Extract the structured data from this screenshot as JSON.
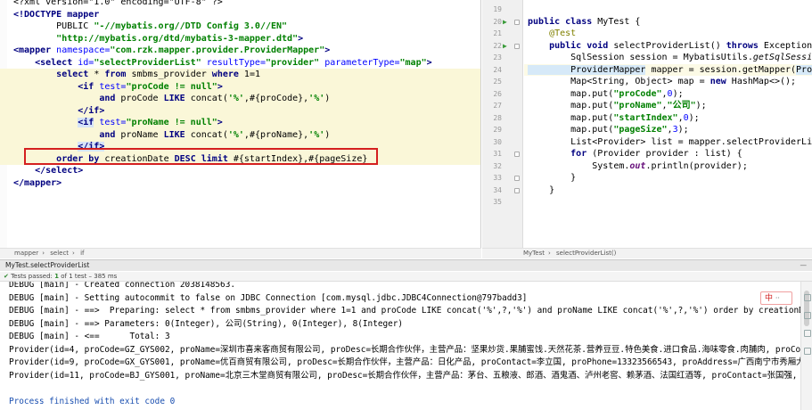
{
  "xml_editor": {
    "lines": [
      [
        {
          "c": "c-pl",
          "t": "<?xml version=\"1.0\" encoding=\"UTF-8\" ?>"
        }
      ],
      [
        {
          "c": "c-tag",
          "t": "<!DOCTYPE mapper"
        }
      ],
      [
        {
          "c": "c-pl",
          "t": "        PUBLIC "
        },
        {
          "c": "c-quoted",
          "t": "\"-//mybatis.org//DTD Config 3.0//EN\""
        }
      ],
      [
        {
          "c": "c-pl",
          "t": "        "
        },
        {
          "c": "c-quoted",
          "t": "\"http://mybatis.org/dtd/mybatis-3-mapper.dtd\""
        },
        {
          "c": "c-tag",
          "t": ">"
        }
      ],
      [
        {
          "c": "c-tag",
          "t": "<mapper "
        },
        {
          "c": "c-attr",
          "t": "namespace="
        },
        {
          "c": "c-str",
          "t": "\"com.rzk.mapper.provider.ProviderMapper\""
        },
        {
          "c": "c-tag",
          "t": ">"
        }
      ],
      [
        {
          "c": "c-tag",
          "t": "    <select "
        },
        {
          "c": "c-attr",
          "t": "id="
        },
        {
          "c": "c-str",
          "t": "\"selectProviderList\" "
        },
        {
          "c": "c-attr",
          "t": "resultType="
        },
        {
          "c": "c-str",
          "t": "\"provider\" "
        },
        {
          "c": "c-attr",
          "t": "parameterType="
        },
        {
          "c": "c-str",
          "t": "\"map\""
        },
        {
          "c": "c-tag",
          "t": ">"
        }
      ],
      [
        {
          "c": "c-sql",
          "t": "        "
        },
        {
          "c": "c-kw",
          "t": "select "
        },
        {
          "c": "c-sql",
          "t": "* "
        },
        {
          "c": "c-kw",
          "t": "from "
        },
        {
          "c": "c-sql",
          "t": "smbms_provider "
        },
        {
          "c": "c-kw",
          "t": "where "
        },
        {
          "c": "c-sql",
          "t": "1=1"
        }
      ],
      [
        {
          "c": "c-pl",
          "t": "            "
        },
        {
          "c": "c-tag",
          "t": "<if "
        },
        {
          "c": "c-attr",
          "t": "test="
        },
        {
          "c": "c-str",
          "t": "\"proCode != null\""
        },
        {
          "c": "c-tag",
          "t": ">"
        }
      ],
      [
        {
          "c": "c-pl",
          "t": "                "
        },
        {
          "c": "c-kw",
          "t": "and "
        },
        {
          "c": "c-sql",
          "t": "proCode "
        },
        {
          "c": "c-kw",
          "t": "LIKE "
        },
        {
          "c": "c-sql",
          "t": "concat("
        },
        {
          "c": "c-quoted",
          "t": "'%'"
        },
        {
          "c": "c-sql",
          "t": ",#{proCode},"
        },
        {
          "c": "c-quoted",
          "t": "'%'"
        },
        {
          "c": "c-sql",
          "t": ")"
        }
      ],
      [
        {
          "c": "c-pl",
          "t": "            "
        },
        {
          "c": "c-tag",
          "t": "</if>"
        }
      ],
      [
        {
          "c": "c-pl",
          "t": "            "
        },
        {
          "c": "c-tag match",
          "t": "<if"
        },
        {
          "c": "c-attr",
          "t": " test="
        },
        {
          "c": "c-str",
          "t": "\"proName != null\""
        },
        {
          "c": "c-tag",
          "t": ">"
        }
      ],
      [
        {
          "c": "c-pl",
          "t": "                "
        },
        {
          "c": "c-kw",
          "t": "and "
        },
        {
          "c": "c-sql",
          "t": "proName "
        },
        {
          "c": "c-kw",
          "t": "LIKE "
        },
        {
          "c": "c-sql",
          "t": "concat("
        },
        {
          "c": "c-quoted",
          "t": "'%'"
        },
        {
          "c": "c-sql",
          "t": ",#{proName},"
        },
        {
          "c": "c-quoted",
          "t": "'%'"
        },
        {
          "c": "c-sql",
          "t": ")"
        }
      ],
      [
        {
          "c": "c-pl",
          "t": "            "
        },
        {
          "c": "c-tag match",
          "t": "</if>"
        }
      ],
      [
        {
          "c": "c-pl",
          "t": "        "
        },
        {
          "c": "c-kw",
          "t": "order by "
        },
        {
          "c": "c-sql",
          "t": "creationDate "
        },
        {
          "c": "c-kw",
          "t": "DESC limit "
        },
        {
          "c": "c-sql",
          "t": "#{startIndex},#{pageSize}"
        }
      ],
      [
        {
          "c": "c-tag",
          "t": "    </select>"
        }
      ],
      [
        {
          "c": "c-tag",
          "t": "</mapper>"
        }
      ]
    ],
    "breadcrumbs": [
      "mapper",
      "select",
      "if"
    ]
  },
  "java_editor": {
    "line_numbers": [
      "19",
      "20",
      "21",
      "22",
      "23",
      "24",
      "25",
      "26",
      "27",
      "28",
      "29",
      "30",
      "31",
      "32",
      "33",
      "34",
      "35"
    ],
    "lines": [
      [
        {
          "c": "",
          "t": ""
        }
      ],
      [
        {
          "c": "j-kw",
          "t": "public class "
        },
        {
          "c": "",
          "t": "MyTest {"
        }
      ],
      [
        {
          "c": "j-ann",
          "t": "    @Test"
        }
      ],
      [
        {
          "c": "j-kw",
          "t": "    public void "
        },
        {
          "c": "",
          "t": "selectProviderList() "
        },
        {
          "c": "j-kw",
          "t": "throws "
        },
        {
          "c": "",
          "t": "Exception {"
        }
      ],
      [
        {
          "c": "",
          "t": "        SqlSession session = MybatisUtils."
        },
        {
          "c": "j-it",
          "t": "getSqlSessionFactory"
        },
        {
          "c": "",
          "t": "();"
        }
      ],
      [
        {
          "c": "j-hlcls",
          "t": "        ProviderMapper"
        },
        {
          "c": "",
          "t": " mapper = session.getMapper("
        },
        {
          "c": "j-hlcls",
          "t": "ProviderMapper"
        },
        {
          "c": "",
          "t": ".c"
        }
      ],
      [
        {
          "c": "",
          "t": "        Map<String, Object> map = "
        },
        {
          "c": "j-kw",
          "t": "new "
        },
        {
          "c": "",
          "t": "HashMap<>();"
        }
      ],
      [
        {
          "c": "",
          "t": "        map.put("
        },
        {
          "c": "j-str",
          "t": "\"proCode\""
        },
        {
          "c": "",
          "t": ","
        },
        {
          "c": "j-num",
          "t": "0"
        },
        {
          "c": "",
          "t": ");"
        }
      ],
      [
        {
          "c": "",
          "t": "        map.put("
        },
        {
          "c": "j-str",
          "t": "\"proName\""
        },
        {
          "c": "",
          "t": ","
        },
        {
          "c": "j-str",
          "t": "\"公司\""
        },
        {
          "c": "",
          "t": ");"
        }
      ],
      [
        {
          "c": "",
          "t": "        map.put("
        },
        {
          "c": "j-str",
          "t": "\"startIndex\""
        },
        {
          "c": "",
          "t": ","
        },
        {
          "c": "j-num",
          "t": "0"
        },
        {
          "c": "",
          "t": ");"
        }
      ],
      [
        {
          "c": "",
          "t": "        map.put("
        },
        {
          "c": "j-str",
          "t": "\"pageSize\""
        },
        {
          "c": "",
          "t": ","
        },
        {
          "c": "j-num",
          "t": "3"
        },
        {
          "c": "",
          "t": ");"
        }
      ],
      [
        {
          "c": "",
          "t": "        List<Provider> list = mapper.selectProviderList(map);"
        }
      ],
      [
        {
          "c": "j-kw",
          "t": "        for "
        },
        {
          "c": "",
          "t": "(Provider provider : list) {"
        }
      ],
      [
        {
          "c": "",
          "t": "            System."
        },
        {
          "c": "j-field",
          "t": "out"
        },
        {
          "c": "",
          "t": ".println(provider);"
        }
      ],
      [
        {
          "c": "",
          "t": "        }"
        }
      ],
      [
        {
          "c": "",
          "t": "    }"
        }
      ],
      [
        {
          "c": "",
          "t": ""
        }
      ]
    ],
    "breadcrumbs": [
      "MyTest",
      "selectProviderList()"
    ]
  },
  "run_panel": {
    "tab_title": "MyTest.selectProviderList",
    "minimize_label": "—",
    "status_prefix": "Tests passed: ",
    "status_ok": "1",
    "status_suffix": " of 1 test – 385 ms",
    "ime_label": "中",
    "ime_dots": "··"
  },
  "console_lines": [
    {
      "cls": "",
      "t": "DEBUG [main] - Created connection 2038148563."
    },
    {
      "cls": "",
      "t": "DEBUG [main] - Setting autocommit to false on JDBC Connection [com.mysql.jdbc.JDBC4Connection@797badd3]"
    },
    {
      "cls": "",
      "t": "DEBUG [main] - ==>  Preparing: select * from smbms_provider where 1=1 and proCode LIKE concat('%',?,'%') and proName LIKE concat('%',?,'%') order by creationDate DESC limit ?,?"
    },
    {
      "cls": "",
      "t": "DEBUG [main] - ==> Parameters: 0(Integer), 公司(String), 0(Integer), 8(Integer)"
    },
    {
      "cls": "",
      "t": "DEBUG [main] - <==      Total: 3"
    },
    {
      "cls": "",
      "t": "Provider(id=4, proCode=GZ_GYS002, proName=深圳市喜来客商贸有限公司, proDesc=长期合作伙伴，主营产品：坚果炒货.果脯蜜饯.天然花茶.营养豆豆.特色美食.进口食品.海味零食.肉脯肉, proContact=林妮1, p"
    },
    {
      "cls": "",
      "t": "Provider(id=9, proCode=GX_GYS001, proName=优百商贸有限公司, proDesc=长期合作伙伴，主营产品：日化产品, proContact=李立国, proPhone=13323566543, proAddress=广西南宁市秀厢大道42-1号, proFax"
    },
    {
      "cls": "",
      "t": "Provider(id=11, proCode=BJ_GYS001, proName=北京三木堂商贸有限公司, proDesc=长期合作伙伴，主营产品：茅台、五粮液、郎酒、酒鬼酒、泸州老窖、赖茅酒、法国红酒等, proContact=张国强, proPhone=135666"
    },
    {
      "cls": "",
      "t": ""
    },
    {
      "cls": "blue",
      "t": "Process finished with exit code 0"
    }
  ]
}
